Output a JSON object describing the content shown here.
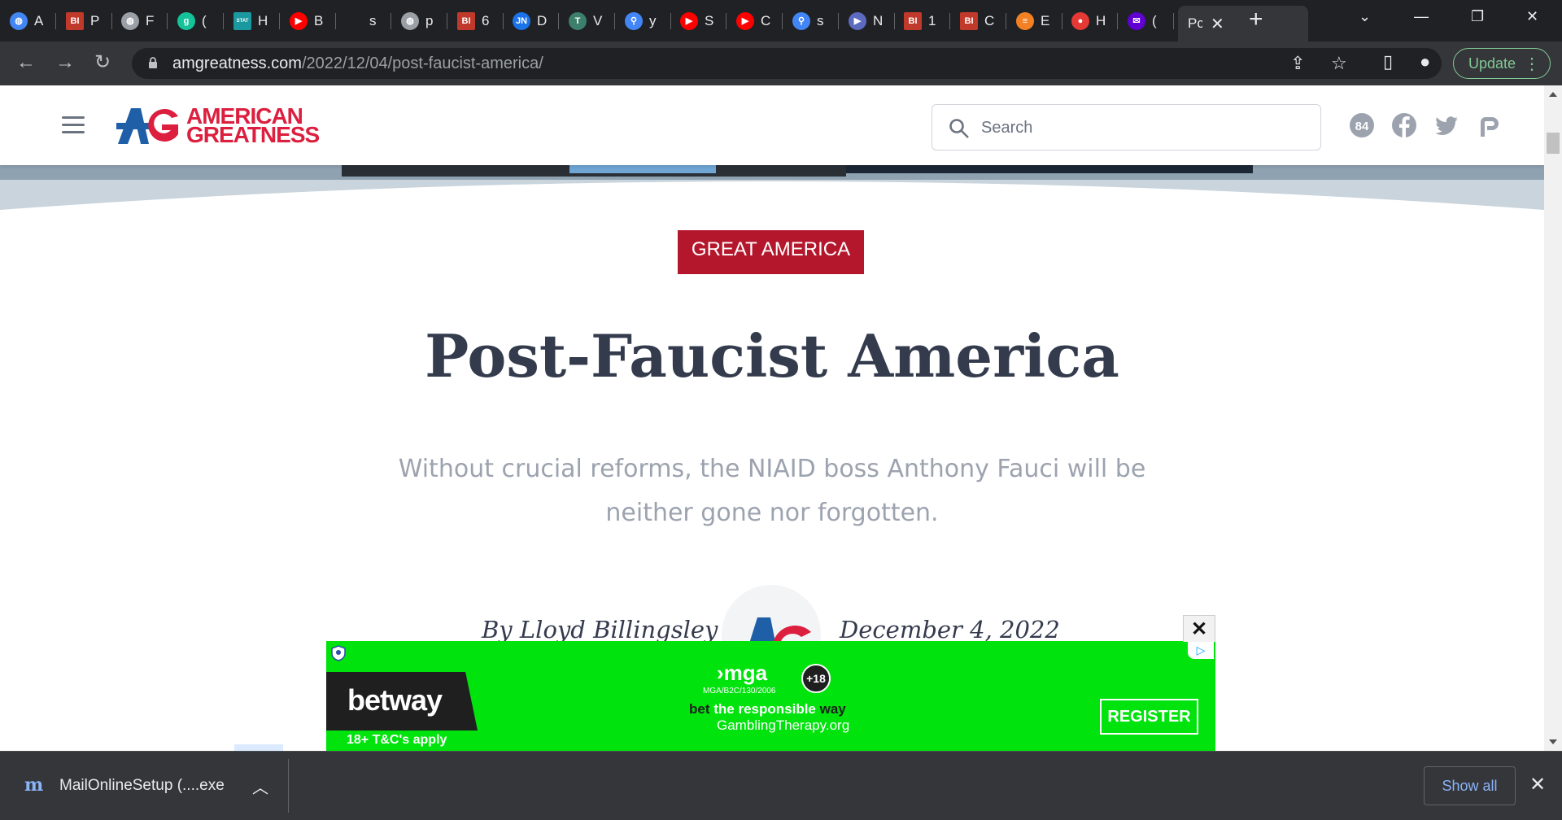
{
  "browser": {
    "tabs": [
      {
        "letter": "A",
        "icon": "globe-icon",
        "color": "#4285f4"
      },
      {
        "letter": "P",
        "icon": "bi-icon",
        "color": "#c0392b"
      },
      {
        "letter": "F",
        "icon": "globe-icon",
        "color": "#9aa0a6"
      },
      {
        "letter": "(",
        "icon": "g-icon",
        "color": "#15c39a"
      },
      {
        "letter": "H",
        "icon": "stat-icon",
        "color": "#1a9aa0"
      },
      {
        "letter": "B",
        "icon": "youtube-icon",
        "color": "#ff0000"
      },
      {
        "letter": "s",
        "icon": "blank-icon",
        "color": "#202124"
      },
      {
        "letter": "p",
        "icon": "globe-icon",
        "color": "#9aa0a6"
      },
      {
        "letter": "6",
        "icon": "bi-icon",
        "color": "#c0392b"
      },
      {
        "letter": "D",
        "icon": "jn-icon",
        "color": "#1a73e8"
      },
      {
        "letter": "V",
        "icon": "tt-icon",
        "color": "#3c7f6a"
      },
      {
        "letter": "y",
        "icon": "search-icon",
        "color": "#4285f4"
      },
      {
        "letter": "S",
        "icon": "youtube-icon",
        "color": "#ff0000"
      },
      {
        "letter": "C",
        "icon": "youtube-icon",
        "color": "#ff0000"
      },
      {
        "letter": "s",
        "icon": "search-icon",
        "color": "#4285f4"
      },
      {
        "letter": "N",
        "icon": "arrow-icon",
        "color": "#5c6bc0"
      },
      {
        "letter": "1",
        "icon": "bi-icon",
        "color": "#c0392b"
      },
      {
        "letter": "C",
        "icon": "bi-icon",
        "color": "#c0392b"
      },
      {
        "letter": "E",
        "icon": "stack-icon",
        "color": "#f48024"
      },
      {
        "letter": "H",
        "icon": "pin-icon",
        "color": "#e53935"
      },
      {
        "letter": "(",
        "icon": "mail-icon",
        "color": "#6001d2"
      }
    ],
    "active_tab": {
      "letter": "Pc"
    },
    "url_host": "amgreatness.com",
    "url_path": "/2022/12/04/post-faucist-america/",
    "update_label": "Update"
  },
  "site": {
    "logo_line1": "AMERICAN",
    "logo_line2": "GREATNESS",
    "search_placeholder": "Search",
    "brand_red": "#dc1f3e",
    "brand_blue": "#1f5fa8"
  },
  "article": {
    "category": "GREAT AMERICA",
    "title": "Post-Faucist America",
    "dek": "Without crucial reforms, the NIAID boss Anthony Fauci will be neither gone nor forgotten.",
    "byline": "By Lloyd Billingsley",
    "date": "December 4, 2022"
  },
  "ad": {
    "brand": "betway",
    "terms": "18+ T&C's apply",
    "mga": "mga",
    "license": "MGA/B2C/130/2006",
    "age": "+18",
    "tagline_a": "bet",
    "tagline_b": "the responsible",
    "tagline_c": "way",
    "site": "GamblingTherapy.org",
    "cta": "REGISTER"
  },
  "downloads": {
    "file": "MailOnlineSetup (....exe",
    "show_all": "Show all"
  }
}
